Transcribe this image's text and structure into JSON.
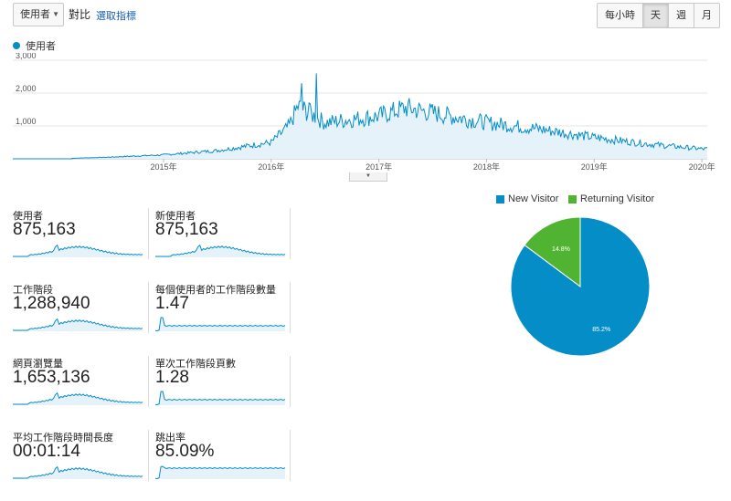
{
  "toolbar": {
    "metric_select": "使用者",
    "vs_label": "對比",
    "choose_metric": "選取指標",
    "granularity": [
      "每小時",
      "天",
      "週",
      "月"
    ],
    "active_granularity": "天"
  },
  "main_chart": {
    "legend": "使用者",
    "y_ticks": [
      "3,000",
      "2,000",
      "1,000"
    ],
    "x_ticks": [
      "2015年",
      "2016年",
      "2017年",
      "2018年",
      "2019年",
      "2020年"
    ]
  },
  "scorecards": [
    {
      "label": "使用者",
      "value": "875,163"
    },
    {
      "label": "新使用者",
      "value": "875,163"
    },
    {
      "label": "工作階段",
      "value": "1,288,940"
    },
    {
      "label": "每個使用者的工作階段數量",
      "value": "1.47"
    },
    {
      "label": "網頁瀏覽量",
      "value": "1,653,136"
    },
    {
      "label": "單次工作階段頁數",
      "value": "1.28"
    },
    {
      "label": "平均工作階段時間長度",
      "value": "00:01:14"
    },
    {
      "label": "跳出率",
      "value": "85.09%"
    }
  ],
  "pie": {
    "legend": [
      {
        "name": "New Visitor",
        "color": "#058dc7"
      },
      {
        "name": "Returning Visitor",
        "color": "#50b432"
      }
    ],
    "slice_labels": [
      "85.2%",
      "14.8%"
    ]
  },
  "chart_data": [
    {
      "type": "area",
      "ylim": [
        0,
        3000
      ],
      "y_ticks": [
        1000,
        2000,
        3000
      ],
      "x": [
        "2014-01",
        "2014-07",
        "2015-01",
        "2015-07",
        "2016-01",
        "2016-03",
        "2016-04",
        "2016-07",
        "2017-01",
        "2017-04",
        "2017-07",
        "2018-01",
        "2018-07",
        "2019-01",
        "2019-07",
        "2020-01"
      ],
      "series": [
        {
          "name": "使用者",
          "values": [
            0,
            50,
            120,
            250,
            500,
            1000,
            1600,
            1100,
            1300,
            1550,
            1400,
            1100,
            900,
            650,
            450,
            300
          ]
        }
      ]
    },
    {
      "type": "pie",
      "categories": [
        "New Visitor",
        "Returning Visitor"
      ],
      "values": [
        85.2,
        14.8
      ]
    }
  ]
}
